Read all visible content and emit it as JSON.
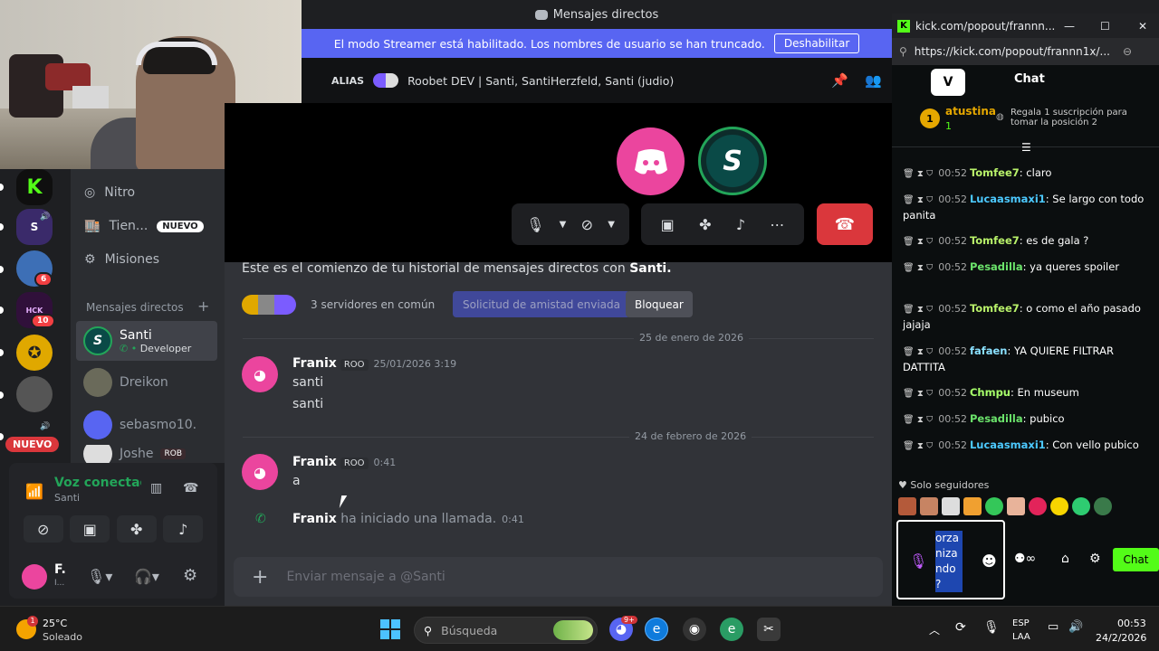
{
  "discord": {
    "window_title": "Mensajes directos",
    "streamer_banner": "El modo Streamer está habilitado. Los nombres de usuario se han truncado.",
    "streamer_button": "Deshabilitar",
    "dm_header": {
      "alias_label": "ALIAS",
      "group_name": "Roobet DEV | Santi, SantiHerzfeld, Santi (judio)"
    },
    "nav": {
      "nitro": "Nitro",
      "shop": "Tien...",
      "shop_badge": "NUEVO",
      "quests": "Misiones",
      "dm_section": "Mensajes directos"
    },
    "server_badges": [
      "6",
      "10"
    ],
    "server_new_badge": "NUEVO",
    "dm_list": [
      {
        "name": "Santi",
        "sub": "Developer"
      },
      {
        "name": "Dreikon",
        "sub": ""
      },
      {
        "name": "sebasmo10.",
        "sub": ""
      },
      {
        "name": "Joshe",
        "sub": "ROB"
      }
    ],
    "voice": {
      "status": "Voz conectada",
      "channel": "Santi"
    },
    "user": {
      "name": "F.",
      "sub": "I..."
    },
    "history_intro_prefix": "Este es el comienzo de tu historial de mensajes directos con ",
    "history_intro_name": "Santi.",
    "mutual_servers": "3 servidores en común",
    "friend_request_btn": "Solicitud de amistad enviada",
    "block_btn": "Bloquear",
    "dates": [
      "25 de enero de 2026",
      "24 de febrero de 2026"
    ],
    "messages": [
      {
        "author": "Franix",
        "tag": "ROO",
        "time": "25/01/2026 3:19",
        "lines": [
          "santi",
          "santi"
        ]
      },
      {
        "author": "Franix",
        "tag": "ROO",
        "time": "0:41",
        "lines": [
          "a"
        ]
      }
    ],
    "call_event": {
      "author": "Franix",
      "text": "ha iniciado una llamada.",
      "time": "0:41"
    },
    "input_placeholder": "Enviar mensaje a @Santi"
  },
  "kick": {
    "window_title": "kick.com/popout/frannn...",
    "url": "https://kick.com/popout/frannn1x/...",
    "chat_title": "Chat",
    "top_gifter": {
      "rank": "1",
      "name": "atustina",
      "count": "1"
    },
    "gift_prompt": "Regala 1 suscripción para tomar la posición 2",
    "messages": [
      {
        "time": "00:52",
        "user": "Tomfee7",
        "color": "#b9f26a",
        "text": "claro"
      },
      {
        "time": "00:52",
        "user": "Lucaasmaxi1",
        "color": "#4cc9ff",
        "text": "Se largo con todo panita"
      },
      {
        "time": "00:52",
        "user": "Tomfee7",
        "color": "#b9f26a",
        "text": "es de gala ?"
      },
      {
        "time": "00:52",
        "user": "Pesadilla",
        "color": "#6be36b",
        "text": "ya queres spoiler"
      },
      {
        "time": "00:52",
        "user": "Tomfee7",
        "color": "#b9f26a",
        "text": "o como el año pasado jajaja"
      },
      {
        "time": "00:52",
        "user": "fafaen",
        "color": "#8ae0ff",
        "text": "YA QUIERE FILTRAR DATTITA"
      },
      {
        "time": "00:52",
        "user": "Chmpu",
        "color": "#a7ff6a",
        "text": "En museum"
      },
      {
        "time": "00:52",
        "user": "Pesadilla",
        "color": "#6be36b",
        "text": "pubico"
      },
      {
        "time": "00:52",
        "user": "Lucaasmaxi1",
        "color": "#4cc9ff",
        "text": "Con vello pubico"
      }
    ],
    "followers_only": "Solo seguidores",
    "input_text": "orza niza ndo ?",
    "send_label": "Chat"
  },
  "taskbar": {
    "weather_temp": "25°C",
    "weather_desc": "Soleado",
    "search_placeholder": "Búsqueda",
    "lang": "ESP",
    "lang2": "LAA",
    "time": "00:53",
    "date": "24/2/2026",
    "weather_badge": "1",
    "discord_badge": "9+"
  },
  "colors": {
    "discord_blurple": "#5865f2",
    "discord_pink": "#eb459e",
    "kick_green": "#53fc18",
    "hangup_red": "#da373c"
  }
}
